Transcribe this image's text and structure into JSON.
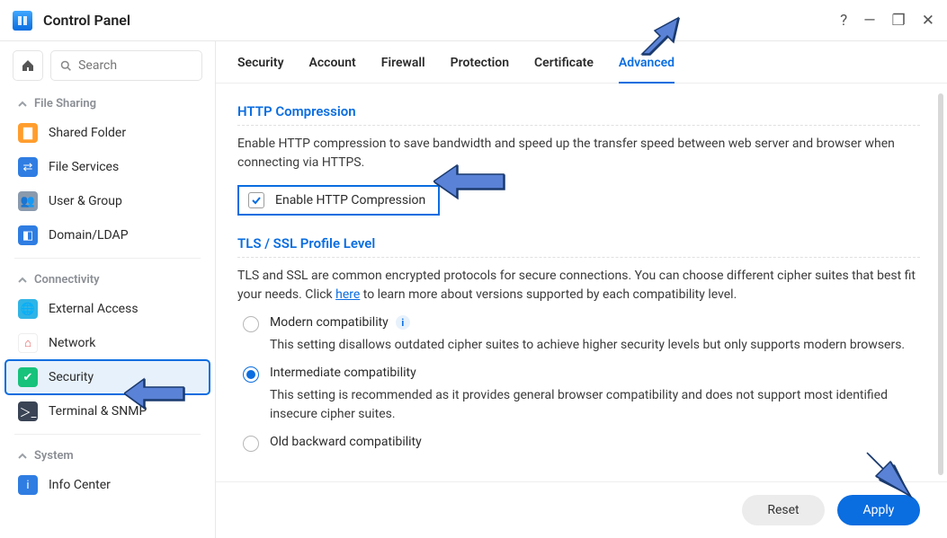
{
  "window": {
    "title": "Control Panel"
  },
  "search": {
    "placeholder": "Search"
  },
  "sidebar": {
    "groups": [
      {
        "label": "File Sharing"
      },
      {
        "label": "Connectivity"
      },
      {
        "label": "System"
      }
    ],
    "items": {
      "shared_folder": "Shared Folder",
      "file_services": "File Services",
      "user_group": "User & Group",
      "domain_ldap": "Domain/LDAP",
      "external_access": "External Access",
      "network": "Network",
      "security": "Security",
      "terminal_snmp": "Terminal & SNMP",
      "info_center": "Info Center"
    }
  },
  "tabs": {
    "security": "Security",
    "account": "Account",
    "firewall": "Firewall",
    "protection": "Protection",
    "certificate": "Certificate",
    "advanced": "Advanced"
  },
  "http": {
    "title": "HTTP Compression",
    "desc": "Enable HTTP compression to save bandwidth and speed up the transfer speed between web server and browser when connecting via HTTPS.",
    "checkbox": "Enable HTTP Compression"
  },
  "tls": {
    "title": "TLS / SSL Profile Level",
    "desc_pre": "TLS and SSL are common encrypted protocols for secure connections. You can choose different cipher suites that best fit your needs. Click ",
    "desc_link": "here",
    "desc_post": " to learn more about versions supported by each compatibility level.",
    "options": {
      "modern": {
        "label": "Modern compatibility",
        "desc": "This setting disallows outdated cipher suites to achieve higher security levels but only supports modern browsers."
      },
      "intermediate": {
        "label": "Intermediate compatibility",
        "desc": "This setting is recommended as it provides general browser compatibility and does not support most identified insecure cipher suites."
      },
      "old": {
        "label": "Old backward compatibility"
      }
    }
  },
  "footer": {
    "reset": "Reset",
    "apply": "Apply"
  }
}
